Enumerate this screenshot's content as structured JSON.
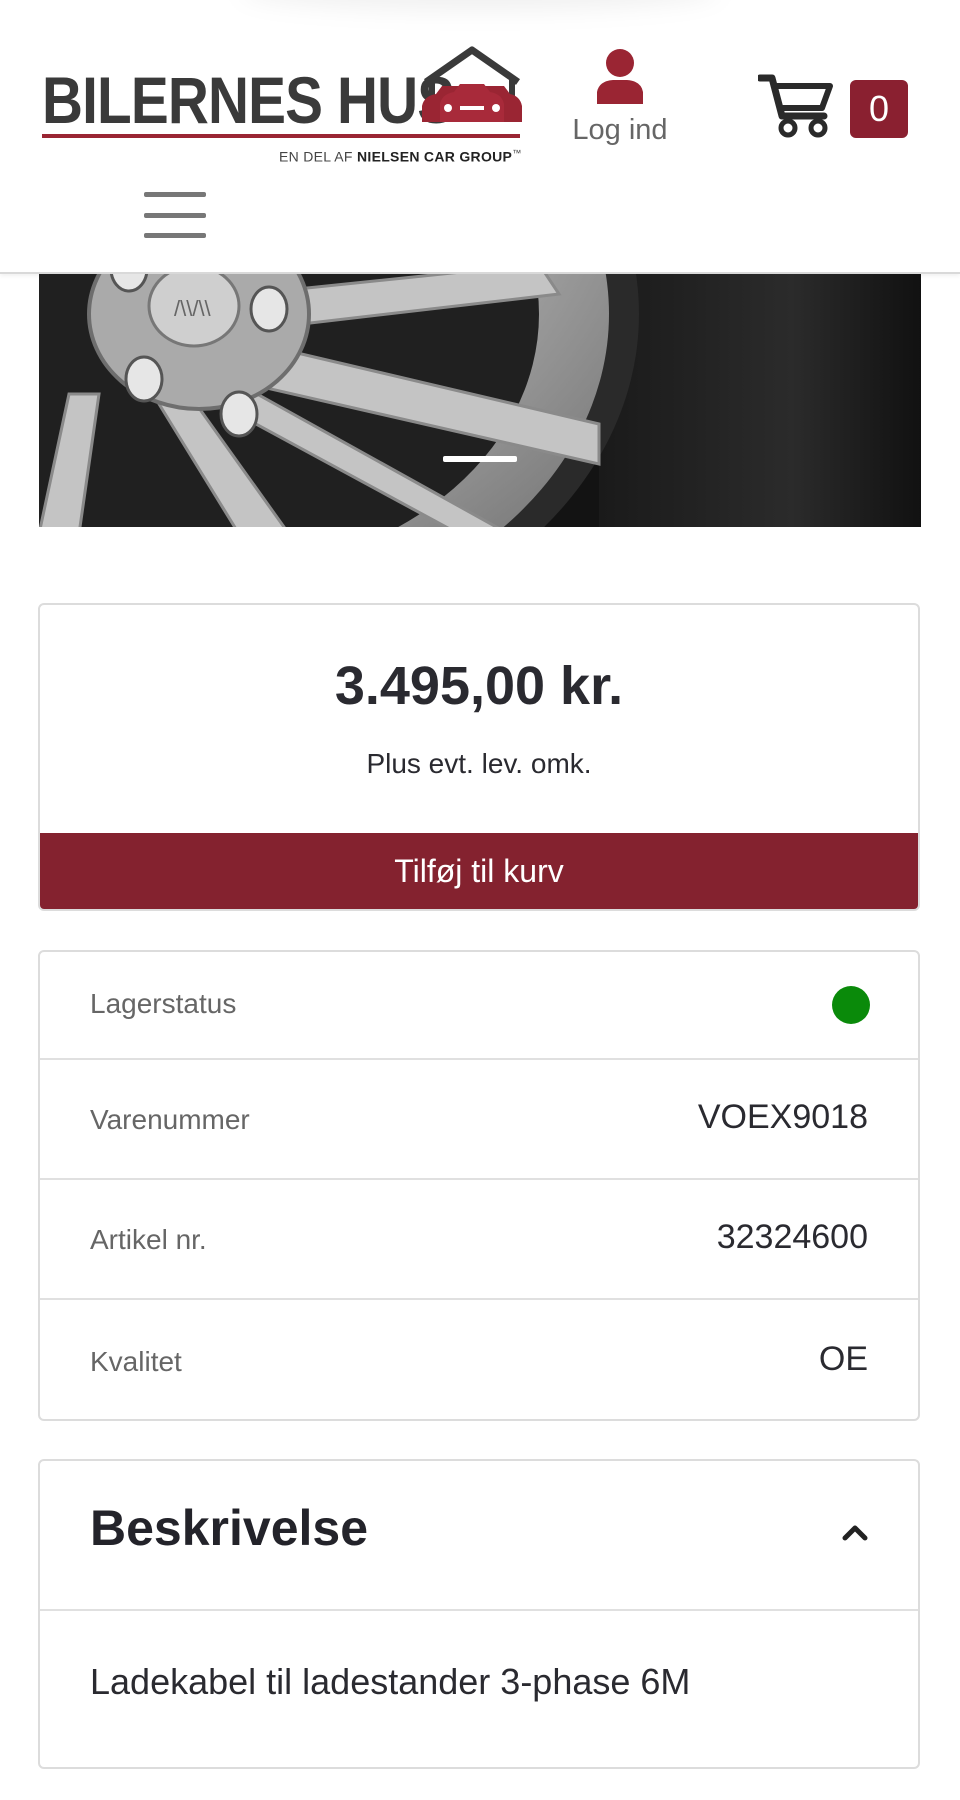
{
  "brand": {
    "name": "BILERNES HUS",
    "tagline_prefix": "EN DEL AF",
    "tagline_group": "NIELSEN CAR GROUP",
    "tagline_mark": "™",
    "accent_color": "#84222f"
  },
  "header": {
    "login_label": "Log ind",
    "login_icon": "user-icon",
    "cart_icon": "cart-icon",
    "cart_count": "0",
    "menu_icon": "hamburger-menu-icon"
  },
  "product": {
    "price": "3.495,00 kr.",
    "price_note": "Plus evt. lev. omk.",
    "add_to_cart_label": "Tilføj til kurv",
    "specs": [
      {
        "label": "Lagerstatus",
        "value": "",
        "status_color": "#0a8a0a"
      },
      {
        "label": "Varenummer",
        "value": "VOEX9018"
      },
      {
        "label": "Artikel nr.",
        "value": "32324600"
      },
      {
        "label": "Kvalitet",
        "value": "OE"
      }
    ],
    "description": {
      "title": "Beskrivelse",
      "text": "Ladekabel til ladestander 3-phase 6M",
      "toggle_icon": "chevron-up-icon"
    }
  }
}
